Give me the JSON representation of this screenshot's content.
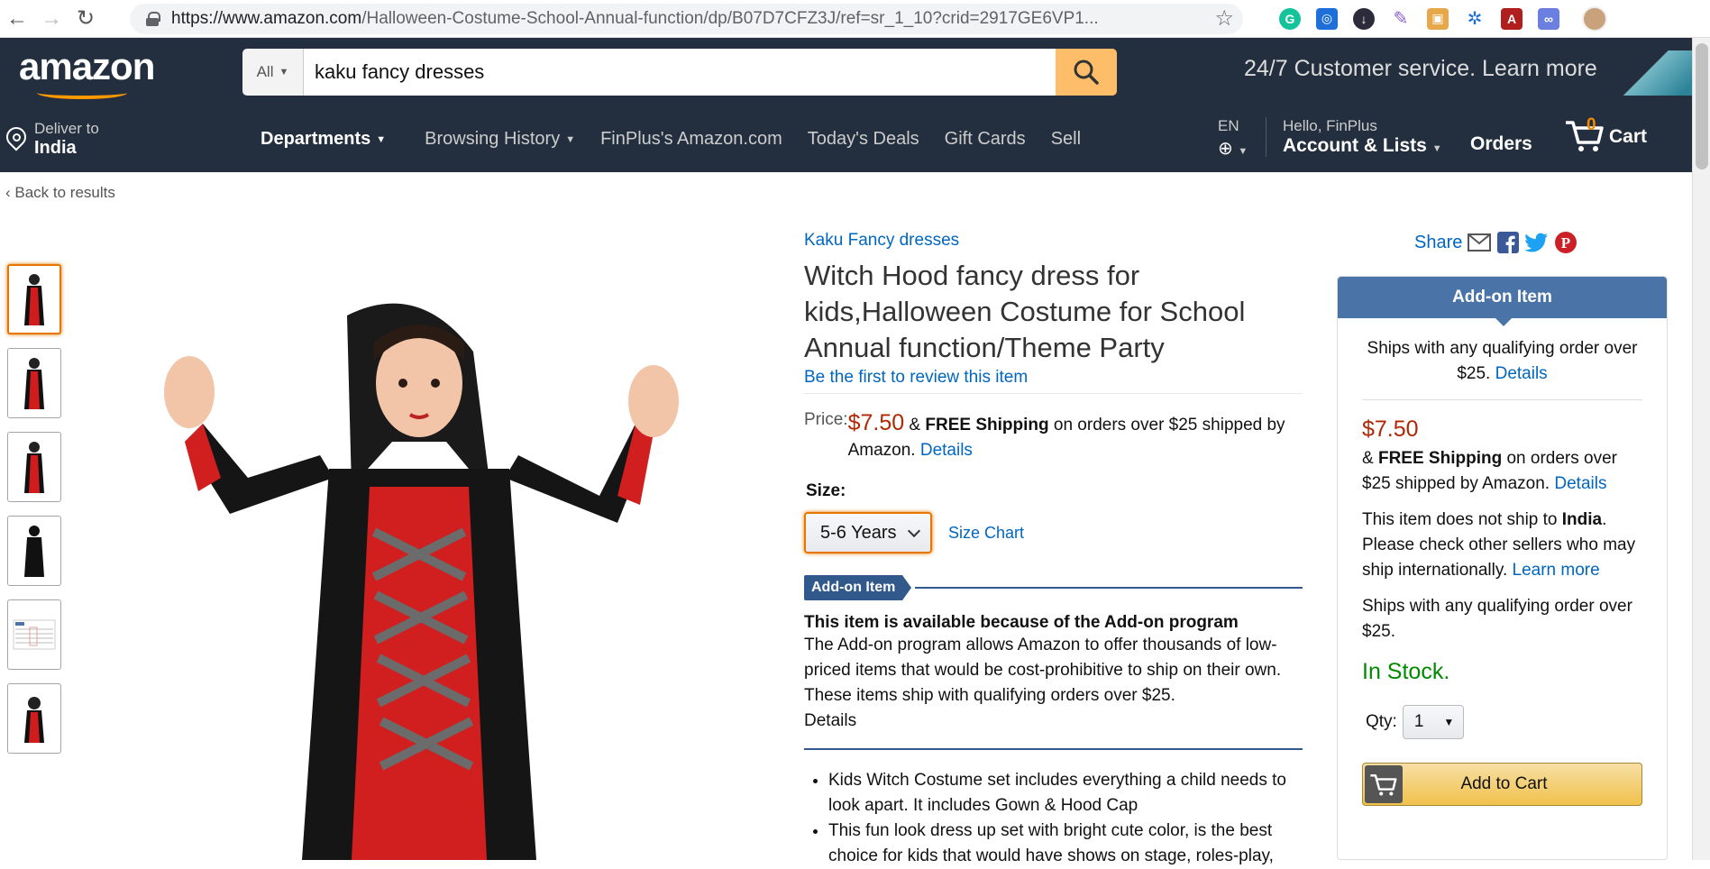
{
  "browser": {
    "url_host": "https://www.amazon.com",
    "url_path": "/Halloween-Costume-School-Annual-function/dp/B07D7CFZ3J/ref=sr_1_10?crid=2917GE6VP1..."
  },
  "header": {
    "logo": "amazon",
    "search_dept": "All",
    "search_value": "kaku fancy dresses",
    "promo": "24/7 Customer service. Learn more",
    "deliver_line1": "Deliver to",
    "deliver_line2": "India",
    "nav_departments": "Departments",
    "nav_links": [
      "Browsing History",
      "FinPlus's Amazon.com",
      "Today's Deals",
      "Gift Cards",
      "Sell"
    ],
    "lang": "EN",
    "account_line1": "Hello, FinPlus",
    "account_line2": "Account & Lists",
    "orders": "Orders",
    "cart_count": "0",
    "cart_label": "Cart"
  },
  "breadcrumb": {
    "back": "‹ Back to results"
  },
  "product": {
    "brand": "Kaku Fancy dresses",
    "title": "Witch Hood fancy dress for kids,Halloween Costume for School Annual function/Theme Party",
    "review_link": "Be the first to review this item",
    "price_label": "Price:",
    "price": "$7.50",
    "shipping_amp": "&",
    "shipping_free": "FREE Shipping",
    "shipping_rest": "on orders over $25 shipped by Amazon.",
    "details": "Details",
    "size_label": "Size:",
    "size_value": "5-6 Years",
    "size_chart": "Size Chart",
    "addon_badge": "Add-on Item",
    "addon_title": "This item is available because of the Add-on program",
    "addon_text": "The Add-on program allows Amazon to offer thousands of low-priced items that would be cost-prohibitive to ship on their own. These items ship with qualifying orders over $25.",
    "addon_details": "Details",
    "bullets": [
      "Kids Witch Costume set includes everything a child needs to look apart. It includes Gown & Hood Cap",
      "This fun look dress up set with bright cute color, is the best choice for kids that would have shows on stage, roles-play,"
    ]
  },
  "share": {
    "label": "Share"
  },
  "buybox": {
    "head": "Add-on Item",
    "ships_text": "Ships with any qualifying order over $25.",
    "ships_details": "Details",
    "price": "$7.50",
    "ship_amp": "&",
    "ship_free": "FREE Shipping",
    "ship_rest": "on orders over $25 shipped by Amazon.",
    "ship_details": "Details",
    "noship_pre": "This item does not ship to",
    "noship_country": "India",
    "noship_rest": ". Please check other sellers who may ship internationally.",
    "learn_more": "Learn more",
    "ships_text2": "Ships with any qualifying order over $25.",
    "stock": "In Stock.",
    "qty_label": "Qty:",
    "qty_value": "1",
    "add_to_cart": "Add to Cart"
  },
  "colors": {
    "nav": "#232f3e",
    "link": "#0066c0",
    "price": "#b12704",
    "stock": "#008a00",
    "accent": "#ff9900"
  }
}
